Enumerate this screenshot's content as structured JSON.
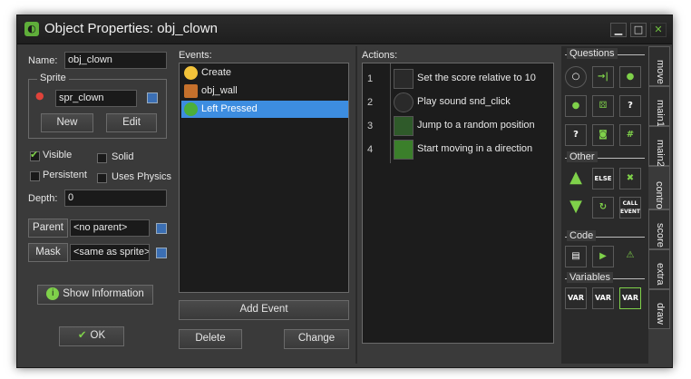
{
  "window": {
    "title": "Object Properties: obj_clown",
    "controls": [
      "▁",
      "□",
      "✕"
    ]
  },
  "left": {
    "name_label": "Name:",
    "name_value": "obj_clown",
    "sprite_group": "Sprite",
    "sprite_value": "spr_clown",
    "new_btn": "New",
    "edit_btn": "Edit",
    "visible_label": "Visible",
    "visible_checked": true,
    "solid_label": "Solid",
    "solid_checked": false,
    "persistent_label": "Persistent",
    "persistent_checked": false,
    "physics_label": "Uses Physics",
    "physics_checked": false,
    "depth_label": "Depth:",
    "depth_value": "0",
    "parent_btn": "Parent",
    "parent_value": "<no parent>",
    "mask_btn": "Mask",
    "mask_value": "<same as sprite>",
    "show_info_btn": "Show Information",
    "ok_btn": "OK"
  },
  "events": {
    "title": "Events:",
    "items": [
      {
        "label": "Create",
        "icon": "bulb-icon",
        "selected": false
      },
      {
        "label": "obj_wall",
        "icon": "collision-icon",
        "selected": false
      },
      {
        "label": "Left Pressed",
        "icon": "mouse-icon",
        "selected": true
      }
    ],
    "add_btn": "Add Event",
    "delete_btn": "Delete",
    "change_btn": "Change"
  },
  "actions": {
    "title": "Actions:",
    "items": [
      {
        "num": "1",
        "text": "Set the score relative to 10",
        "icon": "score-icon"
      },
      {
        "num": "2",
        "text": "Play sound snd_click",
        "icon": "sound-icon"
      },
      {
        "num": "3",
        "text": "Jump to a random position",
        "icon": "jump-random-icon"
      },
      {
        "num": "4",
        "text": "Start moving in a direction",
        "icon": "move-direction-icon"
      }
    ]
  },
  "library": {
    "questions_title": "Questions",
    "other_title": "Other",
    "code_title": "Code",
    "variables_title": "Variables",
    "else_label": "ELSE",
    "call_event_label": "CALL EVENT",
    "var_label": "VAR",
    "tabs": [
      "move",
      "main1",
      "main2",
      "control",
      "score",
      "extra",
      "draw"
    ],
    "active_tab": "control"
  }
}
